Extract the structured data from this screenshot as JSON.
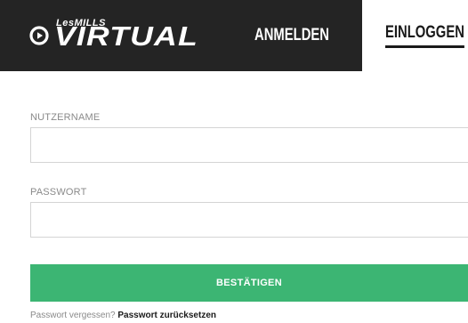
{
  "header": {
    "logo_brand": "LesMILLS",
    "logo_product": "VIRTUAL",
    "tabs": [
      {
        "label": "ANMELDEN",
        "active": false
      },
      {
        "label": "EINLOGGEN",
        "active": true
      }
    ]
  },
  "form": {
    "username_label": "NUTZERNAME",
    "username_value": "",
    "password_label": "PASSWORT",
    "password_value": "",
    "submit_label": "BESTÄTIGEN"
  },
  "footer": {
    "forgot_question": "Passwort vergessen?",
    "reset_link": "Passwort zurücksetzen"
  },
  "colors": {
    "header_bg": "#242424",
    "accent_green": "#3cb573",
    "label_gray": "#8a8a8a"
  },
  "icons": {
    "logo_mark": "play-circle-icon"
  }
}
